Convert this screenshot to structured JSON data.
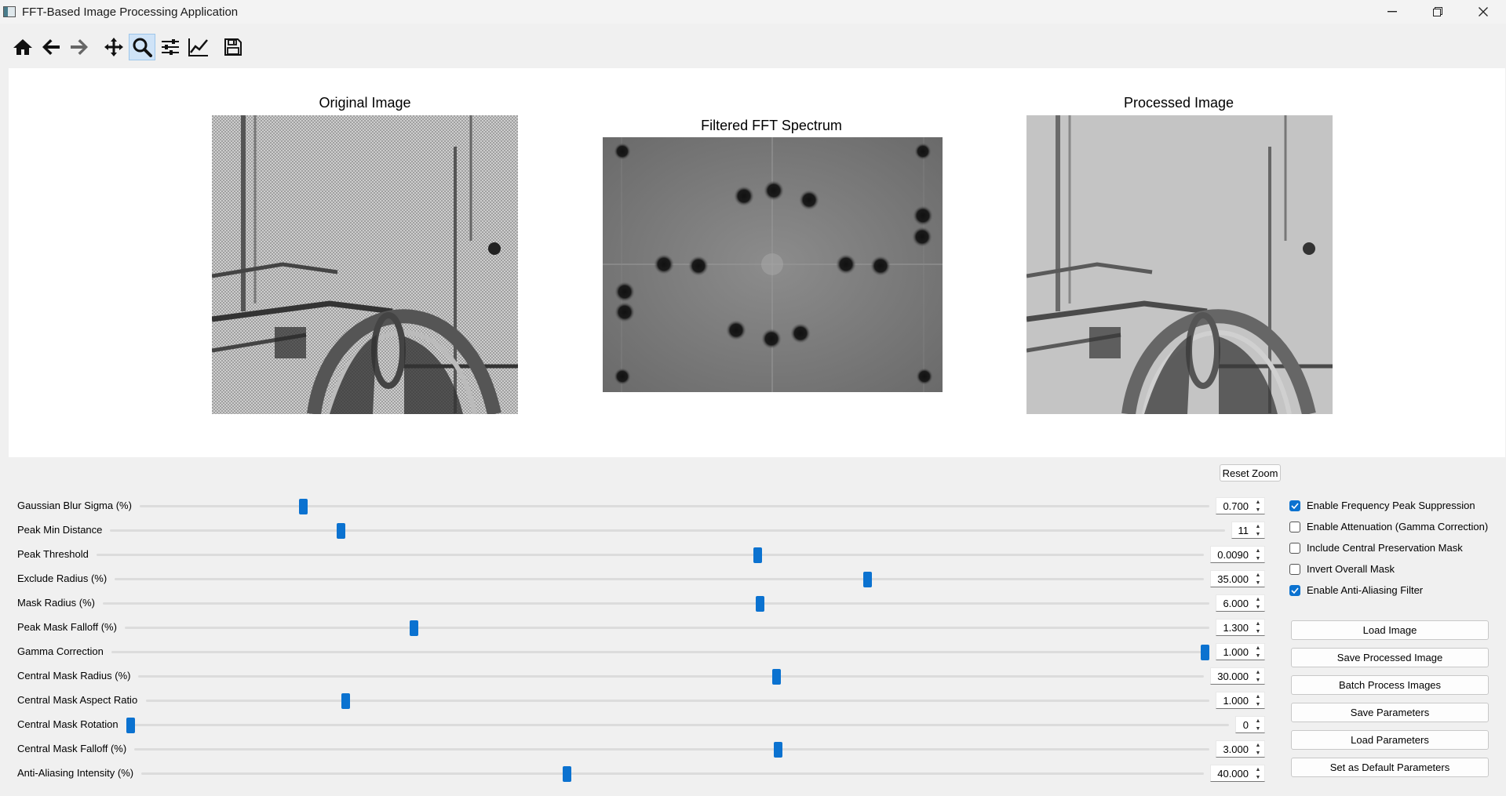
{
  "window": {
    "title": "FFT-Based Image Processing Application"
  },
  "toolbar": {
    "tools": [
      "home-icon",
      "back-arrow-icon",
      "forward-arrow-icon",
      "pan-icon",
      "zoom-icon",
      "configure-subplots-icon",
      "edit-axis-icon",
      "save-icon"
    ],
    "active_tool": "zoom-icon"
  },
  "panels": {
    "original_title": "Original Image",
    "fft_title": "Filtered FFT Spectrum",
    "processed_title": "Processed Image"
  },
  "reset_zoom_label": "Reset Zoom",
  "sliders": [
    {
      "label": "Gaussian Blur Sigma (%)",
      "value": "0.700",
      "fraction": 0.15
    },
    {
      "label": "Peak Min Distance",
      "value": "11",
      "fraction": 0.205
    },
    {
      "label": "Peak Threshold",
      "value": "0.0090",
      "fraction": 0.598
    },
    {
      "label": "Exclude Radius (%)",
      "value": "35.000",
      "fraction": 0.693
    },
    {
      "label": "Mask Radius (%)",
      "value": "6.000",
      "fraction": 0.595
    },
    {
      "label": "Peak Mask Falloff (%)",
      "value": "1.300",
      "fraction": 0.265
    },
    {
      "label": "Gamma Correction",
      "value": "1.000",
      "fraction": 1.0
    },
    {
      "label": "Central Mask Radius (%)",
      "value": "30.000",
      "fraction": 0.6
    },
    {
      "label": "Central Mask Aspect Ratio",
      "value": "1.000",
      "fraction": 0.185
    },
    {
      "label": "Central Mask Rotation",
      "value": "0",
      "fraction": 0.0
    },
    {
      "label": "Central Mask Falloff (%)",
      "value": "3.000",
      "fraction": 0.6
    },
    {
      "label": "Anti-Aliasing Intensity (%)",
      "value": "40.000",
      "fraction": 0.4
    }
  ],
  "checkboxes": [
    {
      "label": "Enable Frequency Peak Suppression",
      "checked": true
    },
    {
      "label": "Enable Attenuation (Gamma Correction)",
      "checked": false
    },
    {
      "label": "Include Central Preservation Mask",
      "checked": false
    },
    {
      "label": "Invert Overall Mask",
      "checked": false
    },
    {
      "label": "Enable Anti-Aliasing Filter",
      "checked": true
    }
  ],
  "buttons": [
    "Load Image",
    "Save Processed Image",
    "Batch Process Images",
    "Save Parameters",
    "Load Parameters",
    "Set as Default Parameters"
  ],
  "colors": {
    "accent": "#0b72d0",
    "canvas": "#ffffff",
    "window_bg": "#f0f0f0"
  }
}
